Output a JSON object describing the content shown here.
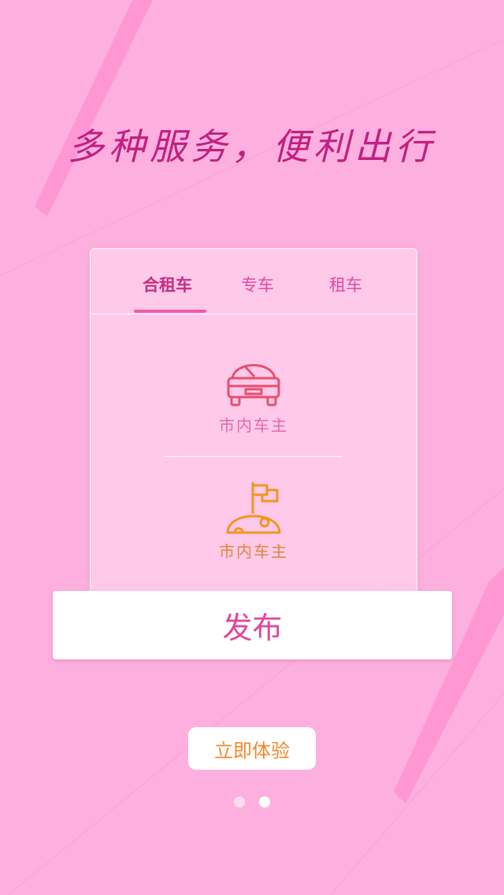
{
  "headline": "多种服务，便利出行",
  "tabs": [
    {
      "label": "合租车",
      "active": true
    },
    {
      "label": "专车",
      "active": false
    },
    {
      "label": "租车",
      "active": false
    }
  ],
  "options": [
    {
      "label": "市内车主",
      "icon": "car-icon",
      "color": "#e8506e"
    },
    {
      "label": "市内车主",
      "icon": "flag-icon",
      "color": "#f0961e"
    }
  ],
  "publish_label": "发布",
  "try_label": "立即体验",
  "pagination": {
    "total": 2,
    "active_index": 1
  },
  "colors": {
    "background": "#fdb0e0",
    "accent": "#e0459c",
    "headline": "#c0207f",
    "orange": "#f08a2a"
  }
}
